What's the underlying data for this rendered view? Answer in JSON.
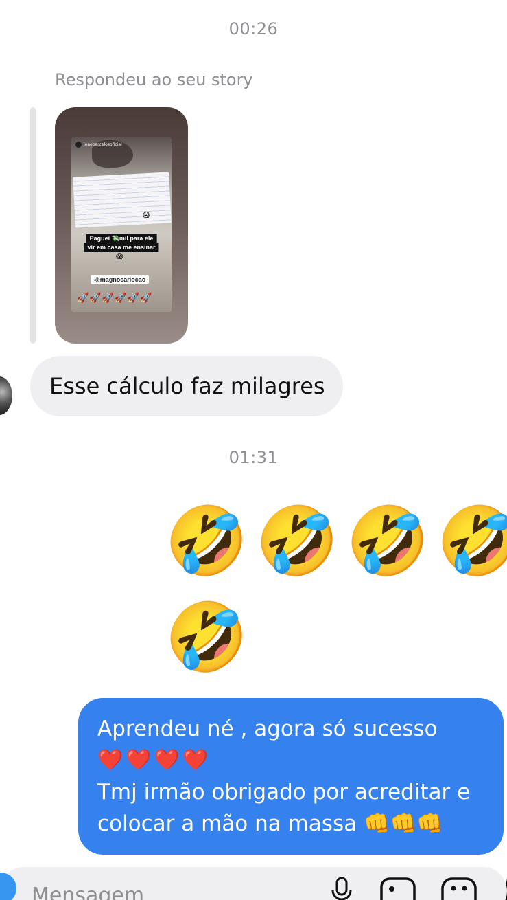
{
  "thread": {
    "timestamp_1": "00:26",
    "reply_label": "Respondeu ao seu story",
    "story": {
      "account_name": "joaobarcelosoficial",
      "caption_line_1": "Paguei 💸mil   para ele",
      "caption_line_2": "vir em casa me ensinar",
      "emoji_top": "😱",
      "emoji_small": "😱",
      "mention": "@magnocariocao",
      "rockets": "🚀🚀🚀🚀🚀🚀"
    },
    "received_message": "Esse cálculo faz milagres",
    "timestamp_2": "01:31",
    "emoji_reaction": [
      "🤣",
      "🤣",
      "🤣",
      "🤣",
      "🤣"
    ],
    "sent_message": {
      "line_1": "Aprendeu né , agora só sucesso",
      "line_2": "❤️❤️❤️❤️",
      "line_3": "Tmj irmão obrigado por acreditar e",
      "line_4": "colocar a mão na massa 👊👊👊"
    }
  },
  "composer": {
    "placeholder": "Mensagem"
  },
  "colors": {
    "sent_bubble": "#3582ee",
    "received_bubble": "#efeff1",
    "meta_text": "#8e8e93"
  },
  "icons": [
    "camera-icon",
    "microphone-icon",
    "gallery-icon",
    "sticker-icon"
  ]
}
